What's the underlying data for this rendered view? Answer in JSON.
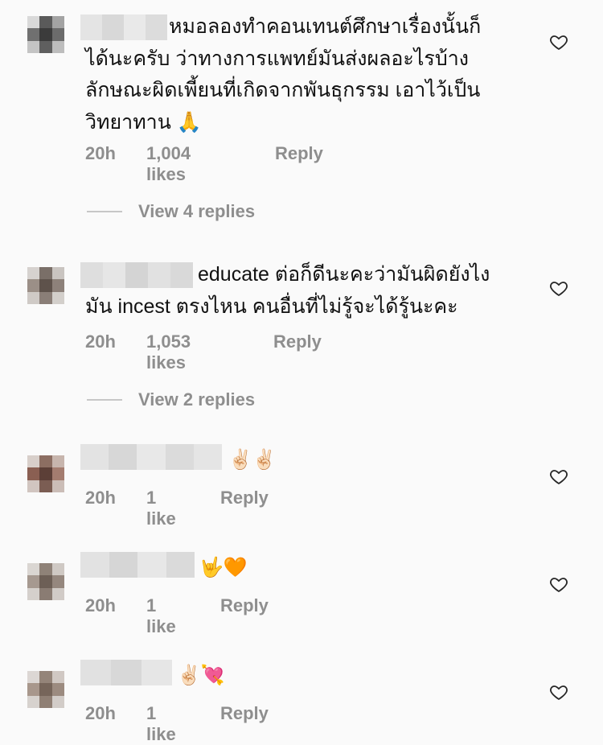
{
  "comments": [
    {
      "text": "หมอลองทำคอนเทนต์ศึกษาเรื่องนั้นก็\nได้นะครับ ว่าทางการแพทย์มันส่งผลอะไรบ้าง\nลักษณะผิดเพี้ยนที่เกิดจากพันธุกรรม เอาไว้เป็น\nวิทยาทาน 🙏",
      "time": "20h",
      "likes": "1,004 likes",
      "reply": "Reply",
      "view_replies": "View 4 replies"
    },
    {
      "text": "educate ต่อก็ดีนะคะว่ามันผิดยังไง\nมัน incest ตรงไหน คนอื่นที่ไม่รู้จะได้รู้นะคะ",
      "time": "20h",
      "likes": "1,053 likes",
      "reply": "Reply",
      "view_replies": "View 2 replies"
    },
    {
      "text": "✌🏻✌🏻",
      "time": "20h",
      "likes": "1 like",
      "reply": "Reply"
    },
    {
      "text": "🤟🧡",
      "time": "20h",
      "likes": "1 like",
      "reply": "Reply"
    },
    {
      "text": "✌🏻💘",
      "time": "20h",
      "likes": "1 like",
      "reply": "Reply"
    }
  ],
  "icons": {
    "like": "heart-icon"
  },
  "colors": {
    "meta": "#8e8e8e",
    "text": "#111111",
    "background": "#fafafa"
  }
}
